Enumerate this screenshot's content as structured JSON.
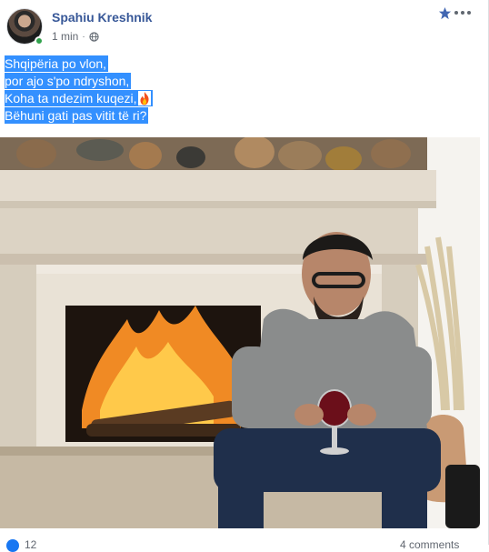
{
  "post": {
    "author": "Spahiu Kreshnik",
    "time": "1 min",
    "separator": "·",
    "privacy_icon": "globe-icon",
    "text_lines": [
      "Shqipëria po vlon,",
      "por ajo s'po ndryshon,",
      "Koha ta ndezim kuqezi,",
      "Bëhuni gati pas vitit të ri?"
    ],
    "flame_emoji": "fire-emoji",
    "photo_description_icon": "photo",
    "reactions_count": "12",
    "comments_count": "4 comments"
  },
  "colors": {
    "author": "#385898",
    "highlight": "#3390ff",
    "online": "#31a24c",
    "like": "#1877f2"
  }
}
